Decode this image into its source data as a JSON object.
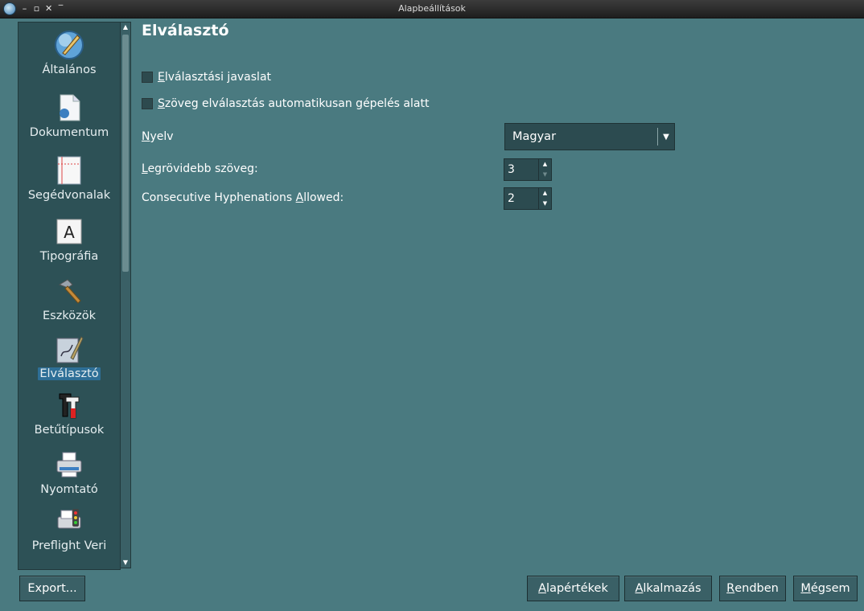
{
  "window": {
    "title": "Alapbeállítások"
  },
  "sidebar": {
    "items": [
      {
        "label": "Általános",
        "icon": "general-settings-icon"
      },
      {
        "label": "Dokumentum",
        "icon": "document-icon"
      },
      {
        "label": "Segédvonalak",
        "icon": "guides-icon"
      },
      {
        "label": "Tipográfia",
        "icon": "typography-icon"
      },
      {
        "label": "Eszközök",
        "icon": "tools-hammer-icon"
      },
      {
        "label": "Elválasztó",
        "icon": "hyphenator-icon",
        "selected": true
      },
      {
        "label": "Betűtípusok",
        "icon": "fonts-icon"
      },
      {
        "label": "Nyomtató",
        "icon": "printer-icon"
      },
      {
        "label": "Preflight Veri",
        "icon": "preflight-icon"
      }
    ]
  },
  "main": {
    "heading": "Elválasztó",
    "checkbox1": {
      "ul": "E",
      "rest": "lválasztási javaslat",
      "checked": false
    },
    "checkbox2": {
      "ul": "S",
      "rest": "zöveg elválasztás automatikusan gépelés alatt",
      "checked": false
    },
    "language": {
      "ul": "N",
      "rest": "yelv",
      "value": "Magyar"
    },
    "shortest": {
      "ul": "L",
      "rest": "egrövidebb szöveg:",
      "value": "3"
    },
    "consecutive": {
      "pre": "Consecutive Hyphenations ",
      "ul": "A",
      "rest": "llowed:",
      "value": "2"
    }
  },
  "footer": {
    "export": "Export...",
    "defaults": {
      "ul": "A",
      "rest": "lapértékek"
    },
    "apply": {
      "ul": "A",
      "rest": "lkalmazás"
    },
    "ok": {
      "ul": "R",
      "rest": "endben"
    },
    "cancel": {
      "ul": "M",
      "rest": "égsem"
    }
  },
  "colors": {
    "background": "#4a7a80",
    "sidebar": "#2d5156",
    "selection": "#2e6f97"
  }
}
